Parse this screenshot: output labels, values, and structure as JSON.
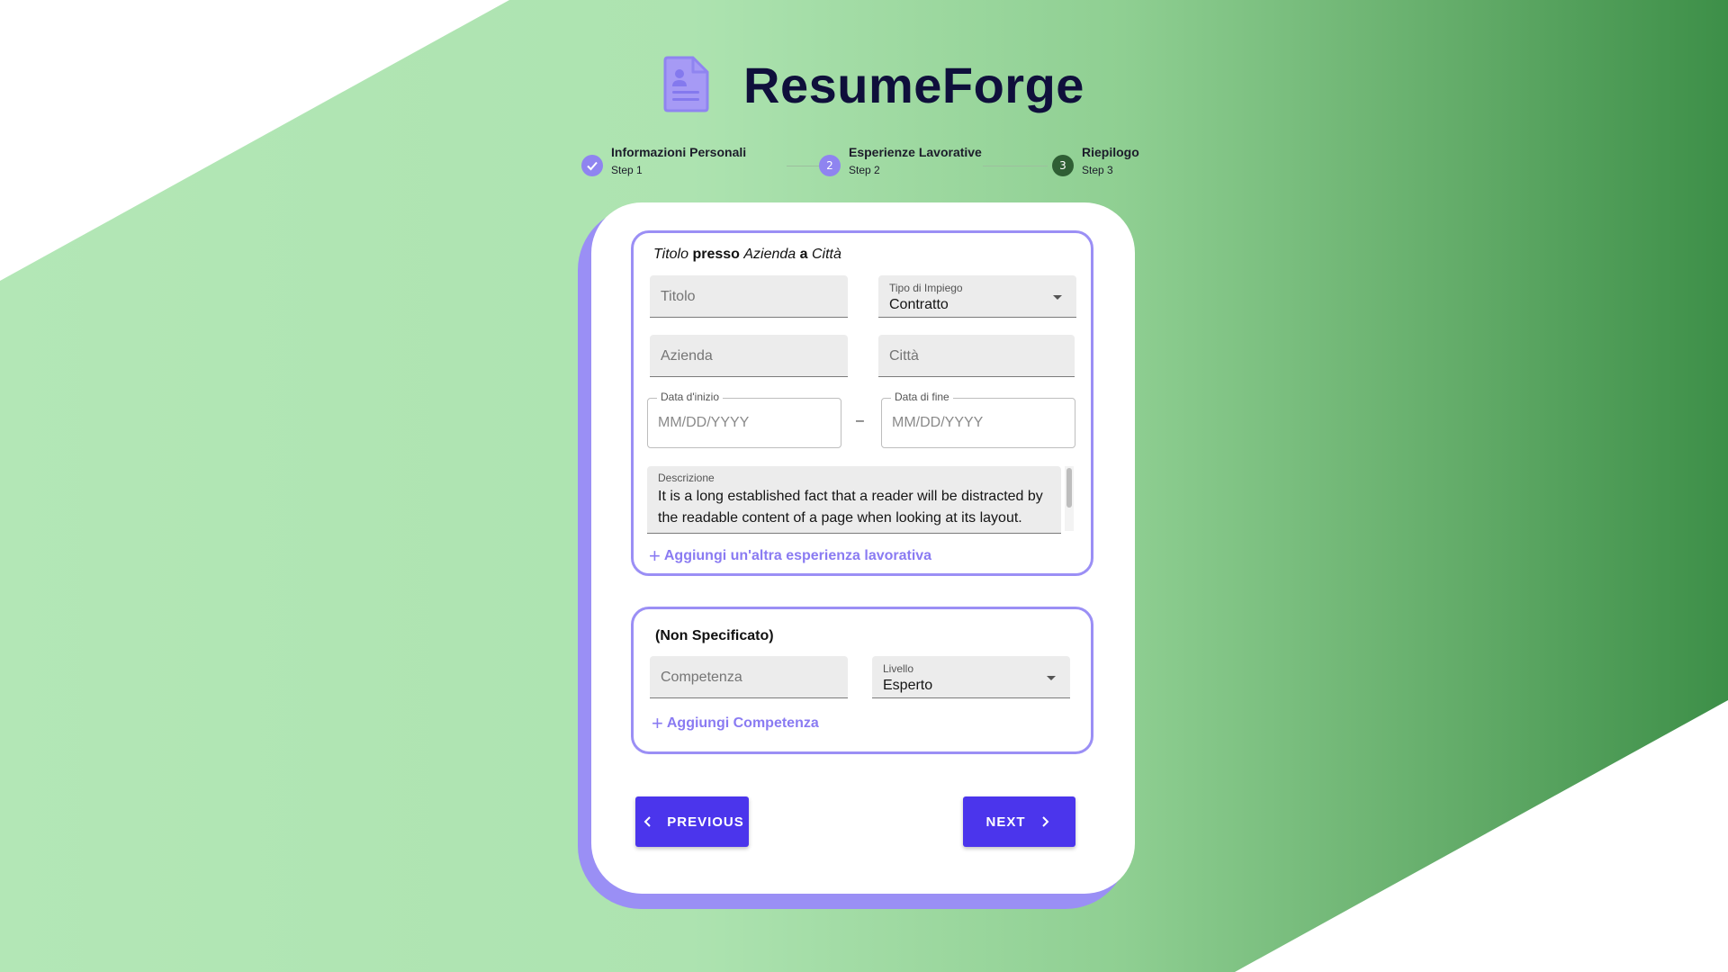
{
  "app": {
    "brand": "ResumeForge"
  },
  "colors": {
    "accent": "#4b35ec",
    "section_border": "#9b8ff5",
    "step_done": "#8f84f0"
  },
  "stepper": {
    "steps": [
      {
        "label": "Informazioni Personali",
        "sub": "Step 1",
        "state": "completed",
        "icon": "check-icon"
      },
      {
        "label": "Esperienze Lavorative",
        "sub": "Step 2",
        "state": "active",
        "number": "2"
      },
      {
        "label": "Riepilogo",
        "sub": "Step 3",
        "state": "pending",
        "number": "3"
      }
    ]
  },
  "experience": {
    "header": {
      "title": "Titolo",
      "presso": "presso",
      "company": "Azienda",
      "a": "a",
      "city": "Città"
    },
    "title_field": {
      "placeholder": "Titolo"
    },
    "employment_type": {
      "label": "Tipo di Impiego",
      "value": "Contratto"
    },
    "company_field": {
      "placeholder": "Azienda"
    },
    "city_field": {
      "placeholder": "Città"
    },
    "start_date": {
      "label": "Data d'inizio",
      "placeholder": "MM/DD/YYYY"
    },
    "separator": "–",
    "end_date": {
      "label": "Data di fine",
      "placeholder": "MM/DD/YYYY"
    },
    "description": {
      "label": "Descrizione",
      "value": "It is a long established fact that a reader will be distracted by the readable content of a page when looking at its layout."
    },
    "add_link": "Aggiungi un'altra esperienza lavorativa"
  },
  "skills": {
    "header": "(Non Specificato)",
    "skill_field": {
      "placeholder": "Competenza"
    },
    "level": {
      "label": "Livello",
      "value": "Esperto"
    },
    "add_link": "Aggiungi Competenza"
  },
  "nav": {
    "previous": "PREVIOUS",
    "next": "NEXT"
  }
}
